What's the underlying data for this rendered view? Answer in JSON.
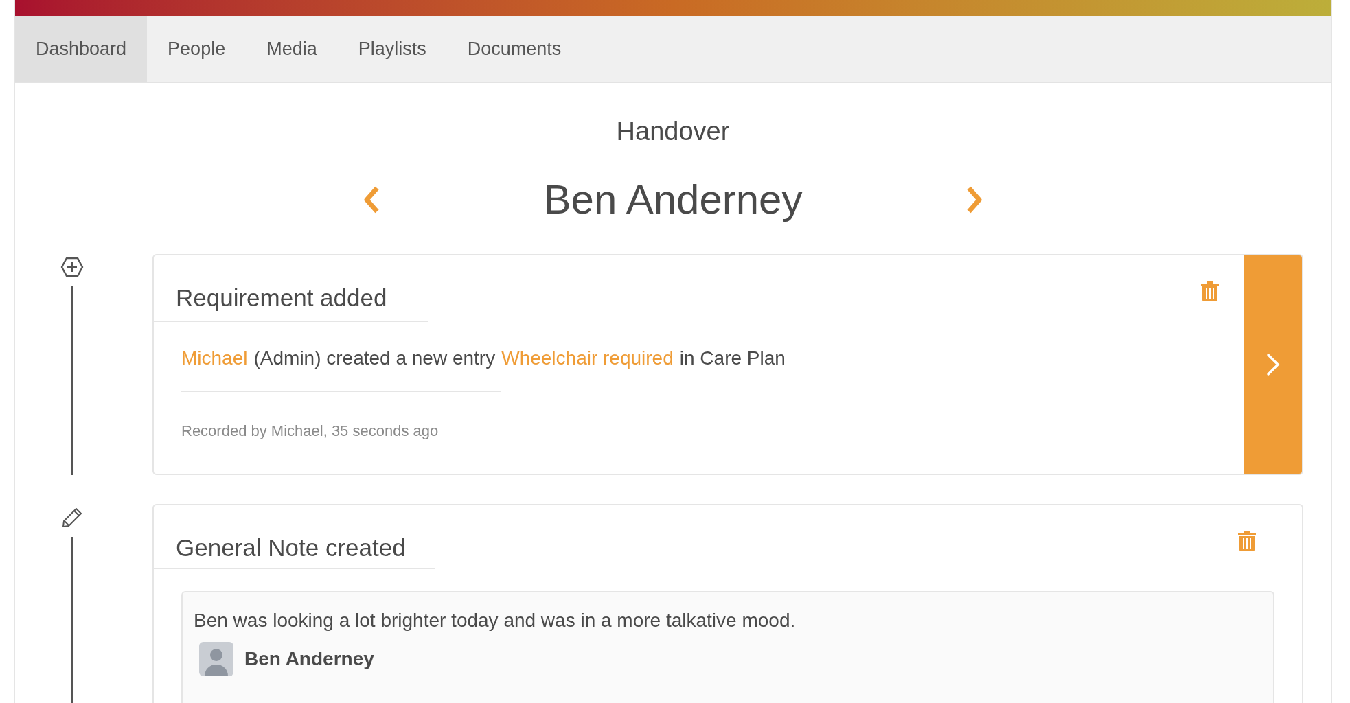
{
  "tabs": [
    {
      "label": "Dashboard",
      "selected": true
    },
    {
      "label": "People",
      "selected": false
    },
    {
      "label": "Media",
      "selected": false
    },
    {
      "label": "Playlists",
      "selected": false
    },
    {
      "label": "Documents",
      "selected": false
    }
  ],
  "page_title": "Handover",
  "person_name": "Ben Anderney",
  "entries": [
    {
      "kind": "requirement",
      "title": "Requirement added",
      "message": [
        {
          "kind": "link",
          "text": "Michael"
        },
        {
          "kind": "text",
          "text": "(Admin) created a new entry"
        },
        {
          "kind": "link",
          "text": "Wheelchair required"
        },
        {
          "kind": "text",
          "text": "in Care Plan"
        }
      ],
      "footer": "Recorded by Michael, 35 seconds ago"
    },
    {
      "kind": "note",
      "title": "General Note created",
      "note": "Ben was looking a lot brighter today and was in a more talkative mood.",
      "author": "Ben Anderney"
    }
  ]
}
